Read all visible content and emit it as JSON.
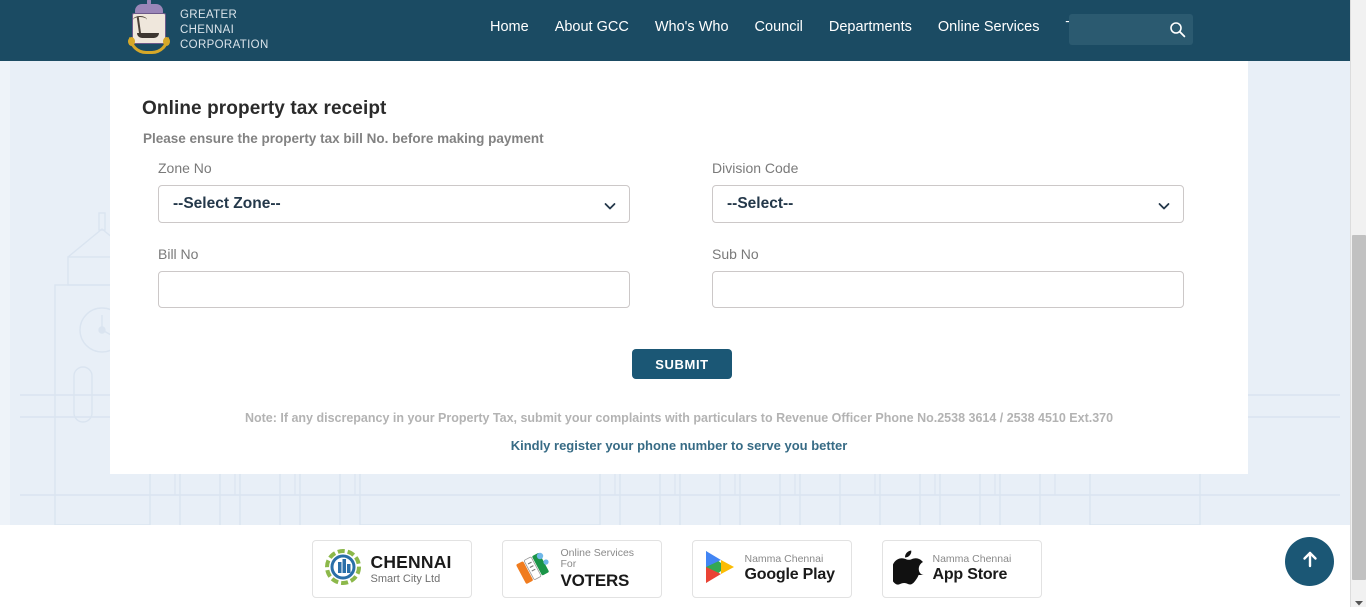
{
  "header": {
    "brand_lines": [
      "GREATER",
      "CHENNAI",
      "CORPORATION"
    ],
    "brand_line1": "GREATER",
    "brand_line2": "CHENNAI",
    "brand_line3": "CORPORATION",
    "nav": [
      {
        "label": "Home"
      },
      {
        "label": "About GCC"
      },
      {
        "label": "Who's Who"
      },
      {
        "label": "Council"
      },
      {
        "label": "Departments"
      },
      {
        "label": "Online Services"
      },
      {
        "label": "Tenders"
      }
    ],
    "search": {
      "value": "",
      "placeholder": ""
    },
    "background_color": "#1b4b63",
    "search_background": "#2b5a70"
  },
  "card": {
    "title": "Online property tax receipt",
    "subtitle": "Please ensure the property tax bill No. before making payment",
    "fields": {
      "zone": {
        "label": "Zone No",
        "value": "--Select Zone--"
      },
      "division": {
        "label": "Division Code",
        "value": "--Select--"
      },
      "bill": {
        "label": "Bill No",
        "value": "",
        "placeholder": ""
      },
      "sub": {
        "label": "Sub No",
        "value": "",
        "placeholder": ""
      }
    },
    "submit_label": "SUBMIT",
    "note": "Note: If any discrepancy in your Property Tax, submit your complaints with particulars to Revenue Officer Phone No.2538 3614 / 2538 4510 Ext.370",
    "note_link": "Kindly register your phone number to serve you better",
    "accent_color": "#1b5775",
    "link_color": "#376b85"
  },
  "footer": {
    "badges": [
      {
        "top": "",
        "main": "CHENNAI",
        "bottom": "Smart City Ltd",
        "icon": "chennai-smart-city-icon"
      },
      {
        "top": "Online Services For",
        "main": "VOTERS",
        "bottom": "",
        "icon": "voters-icon"
      },
      {
        "top": "Namma Chennai",
        "main": "Google Play",
        "bottom": "",
        "icon": "google-play-icon"
      },
      {
        "top": "Namma Chennai",
        "main": "App Store",
        "bottom": "",
        "icon": "apple-icon"
      }
    ]
  },
  "scroll_top": {
    "icon": "arrow-up-icon",
    "color": "#1b5775"
  },
  "scrollbar": {
    "thumb_color": "#c1c1c1",
    "track_color": "#f1f1f1"
  },
  "background": {
    "color": "#e8eff7",
    "watermark": "ripon-building-watermark"
  }
}
